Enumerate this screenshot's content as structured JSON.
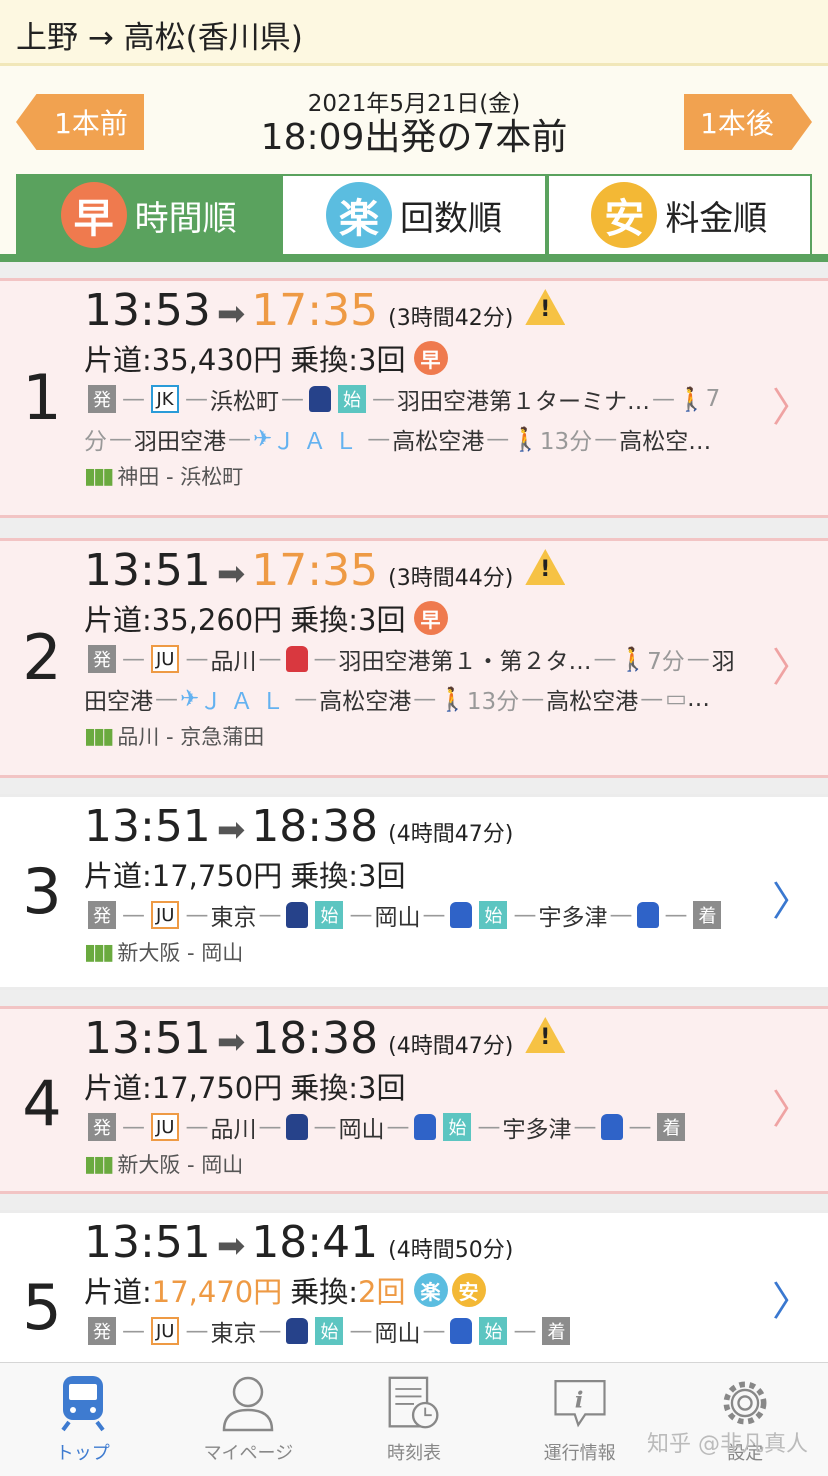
{
  "header": {
    "title": "上野 → 高松(香川県)"
  },
  "nav": {
    "prev_label": "1本前",
    "next_label": "1本後",
    "date": "2021年5月21日(金)",
    "description": "18:09出発の7本前"
  },
  "sort_tabs": [
    {
      "badge": "早",
      "label": "時間順",
      "badge_color": "#ef7a4e"
    },
    {
      "badge": "楽",
      "label": "回数順",
      "badge_color": "#5bbde0"
    },
    {
      "badge": "安",
      "label": "料金順",
      "badge_color": "#f3b835"
    }
  ],
  "routes": [
    {
      "num": "1",
      "depart": "13:53",
      "arrow": "➡",
      "arrive": "17:35",
      "duration": "(3時間42分)",
      "fare_prefix": "片道:",
      "fare": "35,430円",
      "transfer_prefix": "乗換:",
      "transfers": "3回",
      "badge": "早",
      "seg1": {
        "start": "発",
        "line1": "JK",
        "st1": "浜松町",
        "start2": "始",
        "st2": "羽田空港第１ターミナ…",
        "walk1": "7"
      },
      "seg2": {
        "walk1b": "分",
        "st3": "羽田空港",
        "airline": "ＪＡＬ",
        "st4": "高松空港",
        "walk2": "13分",
        "st5": "高松空…"
      },
      "line_info": "神田 - 浜松町"
    },
    {
      "num": "2",
      "depart": "13:51",
      "arrow": "➡",
      "arrive": "17:35",
      "duration": "(3時間44分)",
      "fare_prefix": "片道:",
      "fare": "35,260円",
      "transfer_prefix": "乗換:",
      "transfers": "3回",
      "badge": "早",
      "seg1": {
        "start": "発",
        "line1": "JU",
        "st1": "品川",
        "st2": "羽田空港第１・第２タ…",
        "walk1": "7分",
        "st3a": "羽"
      },
      "seg2": {
        "st3b": "田空港",
        "airline": "ＪＡＬ",
        "st4": "高松空港",
        "walk2": "13分",
        "st5": "高松空港",
        "tail": "…"
      },
      "line_info": "品川 - 京急蒲田"
    },
    {
      "num": "3",
      "depart": "13:51",
      "arrow": "➡",
      "arrive": "18:38",
      "duration": "(4時間47分)",
      "fare_prefix": "片道:",
      "fare": "17,750円",
      "transfer_prefix": "乗換:",
      "transfers": "3回",
      "seg1": {
        "start": "発",
        "line1": "JU",
        "st1": "東京",
        "start2": "始",
        "st2": "岡山",
        "start3": "始",
        "st3": "宇多津",
        "end": "着"
      },
      "line_info": "新大阪 - 岡山"
    },
    {
      "num": "4",
      "depart": "13:51",
      "arrow": "➡",
      "arrive": "18:38",
      "duration": "(4時間47分)",
      "fare_prefix": "片道:",
      "fare": "17,750円",
      "transfer_prefix": "乗換:",
      "transfers": "3回",
      "seg1": {
        "start": "発",
        "line1": "JU",
        "st1": "品川",
        "st2": "岡山",
        "start3": "始",
        "st3": "宇多津",
        "end": "着"
      },
      "line_info": "新大阪 - 岡山"
    },
    {
      "num": "5",
      "depart": "13:51",
      "arrow": "➡",
      "arrive": "18:41",
      "duration": "(4時間50分)",
      "fare_prefix": "片道:",
      "fare": "17,470円",
      "transfer_prefix": "乗換:",
      "transfers": "2回",
      "badge_a": "楽",
      "badge_b": "安",
      "seg1": {
        "start": "発",
        "line1": "JU",
        "st1": "東京",
        "start2": "始",
        "st2": "岡山",
        "start3": "始",
        "end": "着"
      }
    }
  ],
  "tabbar": [
    {
      "label": "トップ"
    },
    {
      "label": "マイページ"
    },
    {
      "label": "時刻表"
    },
    {
      "label": "運行情報"
    },
    {
      "label": "設定"
    }
  ],
  "watermark": "知乎 @非凡真人",
  "colors": {
    "accent_green": "#5aa25e",
    "orange": "#ee9a44",
    "warning_bg": "#fcefef",
    "active_blue": "#3e7bd0"
  }
}
